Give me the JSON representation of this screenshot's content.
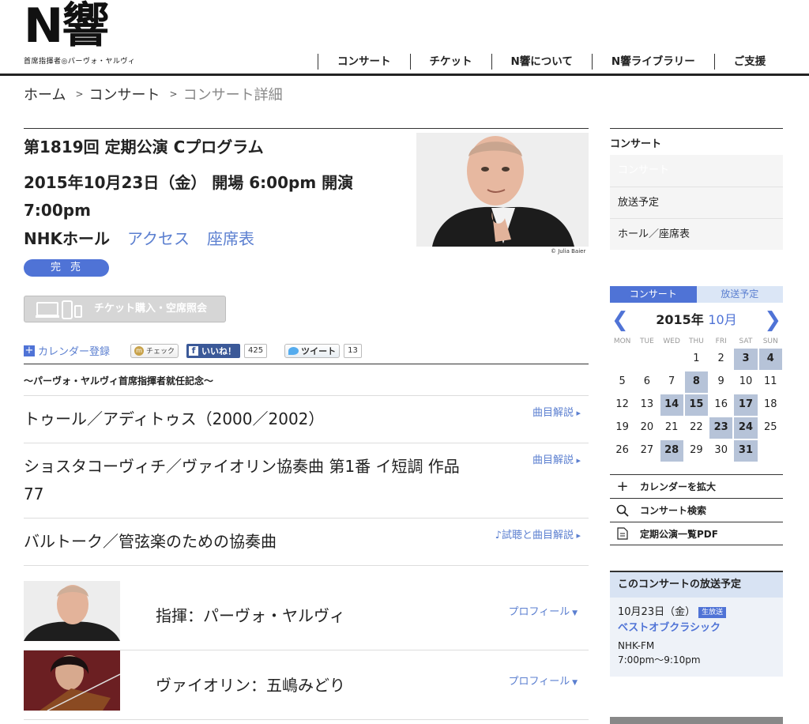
{
  "header": {
    "logo_text": "N響",
    "logo_sub": "首席指揮者◎パーヴォ・ヤルヴィ",
    "nav": [
      "コンサート",
      "チケット",
      "N響について",
      "N響ライブラリー",
      "ご支援"
    ]
  },
  "breadcrumb": [
    "ホーム",
    "コンサート",
    "コンサート詳細"
  ],
  "concert": {
    "title": "第1819回 定期公演 Cプログラム",
    "datetime": "2015年10月23日（金） 開場 6:00pm 開演 7:00pm",
    "venue": "NHKホール",
    "access_link": "アクセス",
    "seat_link": "座席表",
    "status": "完売",
    "ticket_button": "チケット購入・空席照会",
    "photo_credit": "© Julia Baier"
  },
  "social": {
    "calendar": "カレンダー登録",
    "check": "チェック",
    "like": "いいね！",
    "like_count": "425",
    "tweet": "ツイート",
    "tweet_count": "13"
  },
  "subtitle": "〜パーヴォ・ヤルヴィ首席指揮者就任記念〜",
  "program": [
    {
      "work": "トゥール／アディトゥス（2000／2002）",
      "note": "曲目解説"
    },
    {
      "work": "ショスタコーヴィチ／ヴァイオリン協奏曲 第1番 イ短調 作品77",
      "note": "曲目解説"
    },
    {
      "work": "バルトーク／管弦楽のための協奏曲",
      "note": "♪試聴と曲目解説"
    }
  ],
  "artists": [
    {
      "name": "指揮：パーヴォ・ヤルヴィ",
      "profile": "プロフィール"
    },
    {
      "name": "ヴァイオリン：五嶋みどり",
      "profile": "プロフィール"
    }
  ],
  "sidebar": {
    "heading": "コンサート",
    "items": [
      "コンサート",
      "放送予定",
      "ホール／座席表"
    ]
  },
  "calendar": {
    "tabs": [
      "コンサート",
      "放送予定"
    ],
    "year": "2015年",
    "month": "10月",
    "dow": [
      "MON",
      "TUE",
      "WED",
      "THU",
      "FRI",
      "SAT",
      "SUN"
    ],
    "leading_blanks": 3,
    "days": 31,
    "highlighted": [
      3,
      4,
      8,
      14,
      15,
      17,
      23,
      24,
      28,
      31
    ]
  },
  "side_links": [
    {
      "icon": "plus-icon",
      "label": "カレンダーを拡大"
    },
    {
      "icon": "search-icon",
      "label": "コンサート検索"
    },
    {
      "icon": "document-icon",
      "label": "定期公演一覧PDF"
    }
  ],
  "broadcast": {
    "heading": "このコンサートの放送予定",
    "date": "10月23日（金）",
    "tag": "生放送",
    "program": "ベストオブクラシック",
    "channel": "NHK-FM",
    "time": "7:00pm〜9:10pm"
  },
  "colors": {
    "accent": "#4f73d6",
    "link": "#5b7fd0",
    "highlight_day": "#b6c3d8"
  }
}
